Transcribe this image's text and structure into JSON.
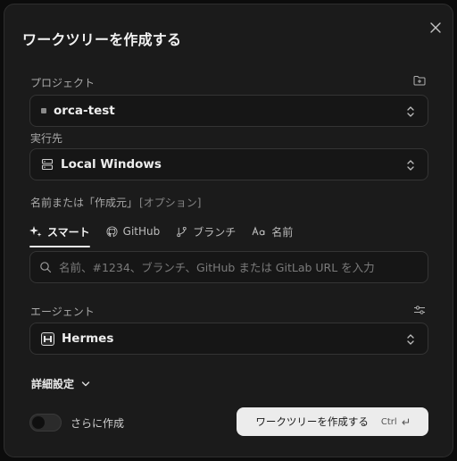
{
  "dialog": {
    "title": "ワークツリーを作成する",
    "close_icon": "close-icon"
  },
  "project": {
    "label": "プロジェクト",
    "value": "orca-test"
  },
  "runner": {
    "label": "実行先",
    "value": "Local Windows"
  },
  "name_section": {
    "label": "名前または「作成元」",
    "optional": "[オプション]"
  },
  "tabs": [
    {
      "label": "スマート",
      "icon": "sparkle-icon",
      "active": true
    },
    {
      "label": "GitHub",
      "icon": "github-icon",
      "active": false
    },
    {
      "label": "ブランチ",
      "icon": "branch-icon",
      "active": false
    },
    {
      "label": "名前",
      "icon": "text-case-icon",
      "active": false
    }
  ],
  "search": {
    "placeholder": "名前、#1234、ブランチ、GitHub または GitLab URL を入力",
    "value": ""
  },
  "agent": {
    "label": "エージェント",
    "value": "Hermes"
  },
  "advanced": {
    "label": "詳細設定"
  },
  "create_more": {
    "label": "さらに作成",
    "enabled": false
  },
  "create_button": {
    "label": "ワークツリーを作成する",
    "shortcut": "Ctrl"
  },
  "colors": {
    "background": "#1b1b1b",
    "field": "#161616",
    "border": "#343434",
    "primary_button": "#ececec"
  }
}
